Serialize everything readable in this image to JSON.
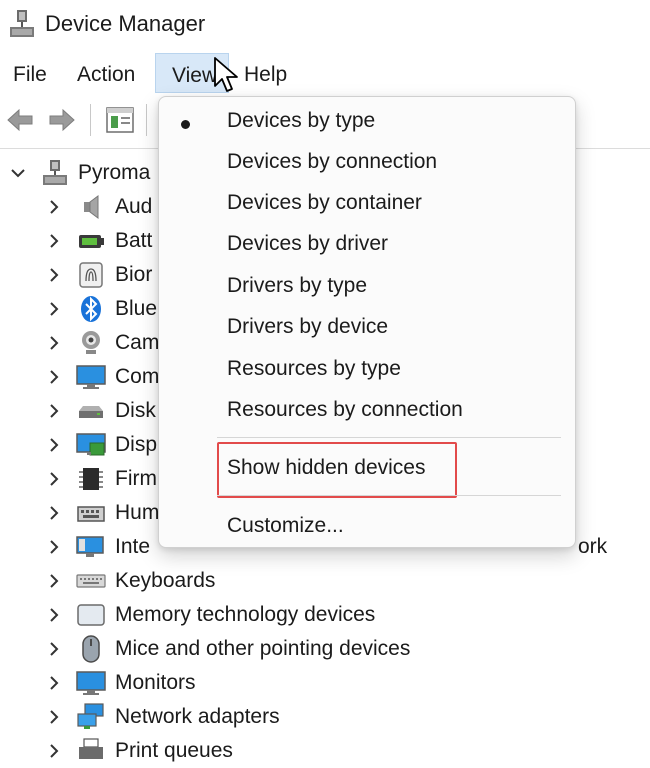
{
  "window": {
    "title": "Device Manager"
  },
  "menubar": {
    "file": "File",
    "action": "Action",
    "view": "View",
    "help": "Help"
  },
  "toolbar": {
    "buttons": [
      "back-arrow-icon",
      "forward-arrow-icon",
      "properties-icon",
      "help-icon"
    ]
  },
  "tree": {
    "root": "Pyroma",
    "items": [
      {
        "label": "Aud",
        "icon": "audio-speaker-icon"
      },
      {
        "label": "Batt",
        "icon": "battery-icon"
      },
      {
        "label": "Bior",
        "icon": "fingerprint-icon"
      },
      {
        "label": "Blue",
        "icon": "bluetooth-icon"
      },
      {
        "label": "Cam",
        "icon": "webcam-icon"
      },
      {
        "label": "Com",
        "icon": "computer-monitor-icon"
      },
      {
        "label": "Disk",
        "icon": "disk-drive-icon"
      },
      {
        "label": "Disp",
        "icon": "display-adapter-icon"
      },
      {
        "label": "Firm",
        "icon": "chip-icon"
      },
      {
        "label": "Hum",
        "icon": "keyboard-hid-icon"
      },
      {
        "label": "Inte",
        "icon": "network-monitor-icon"
      },
      {
        "label": "Keyboards",
        "icon": "keyboard-icon"
      },
      {
        "label": "Memory technology devices",
        "icon": "memory-card-icon"
      },
      {
        "label": "Mice and other pointing devices",
        "icon": "mouse-icon"
      },
      {
        "label": "Monitors",
        "icon": "monitor-icon"
      },
      {
        "label": "Network adapters",
        "icon": "network-adapter-icon"
      },
      {
        "label": "Print queues",
        "icon": "printer-icon"
      }
    ],
    "partial_text_behind_menu": "ork"
  },
  "view_menu": {
    "items": [
      {
        "label": "Devices by type",
        "checked": true
      },
      {
        "label": "Devices by connection",
        "checked": false
      },
      {
        "label": "Devices by container",
        "checked": false
      },
      {
        "label": "Devices by driver",
        "checked": false
      },
      {
        "label": "Drivers by type",
        "checked": false
      },
      {
        "label": "Drivers by device",
        "checked": false
      },
      {
        "label": "Resources by type",
        "checked": false
      },
      {
        "label": "Resources by connection",
        "checked": false
      }
    ],
    "show_hidden": "Show hidden devices",
    "customize": "Customize..."
  },
  "colors": {
    "highlight_box": "#e24b4b",
    "menu_view_bg": "#d8e8f8",
    "accent_blue": "#1a73d9"
  }
}
